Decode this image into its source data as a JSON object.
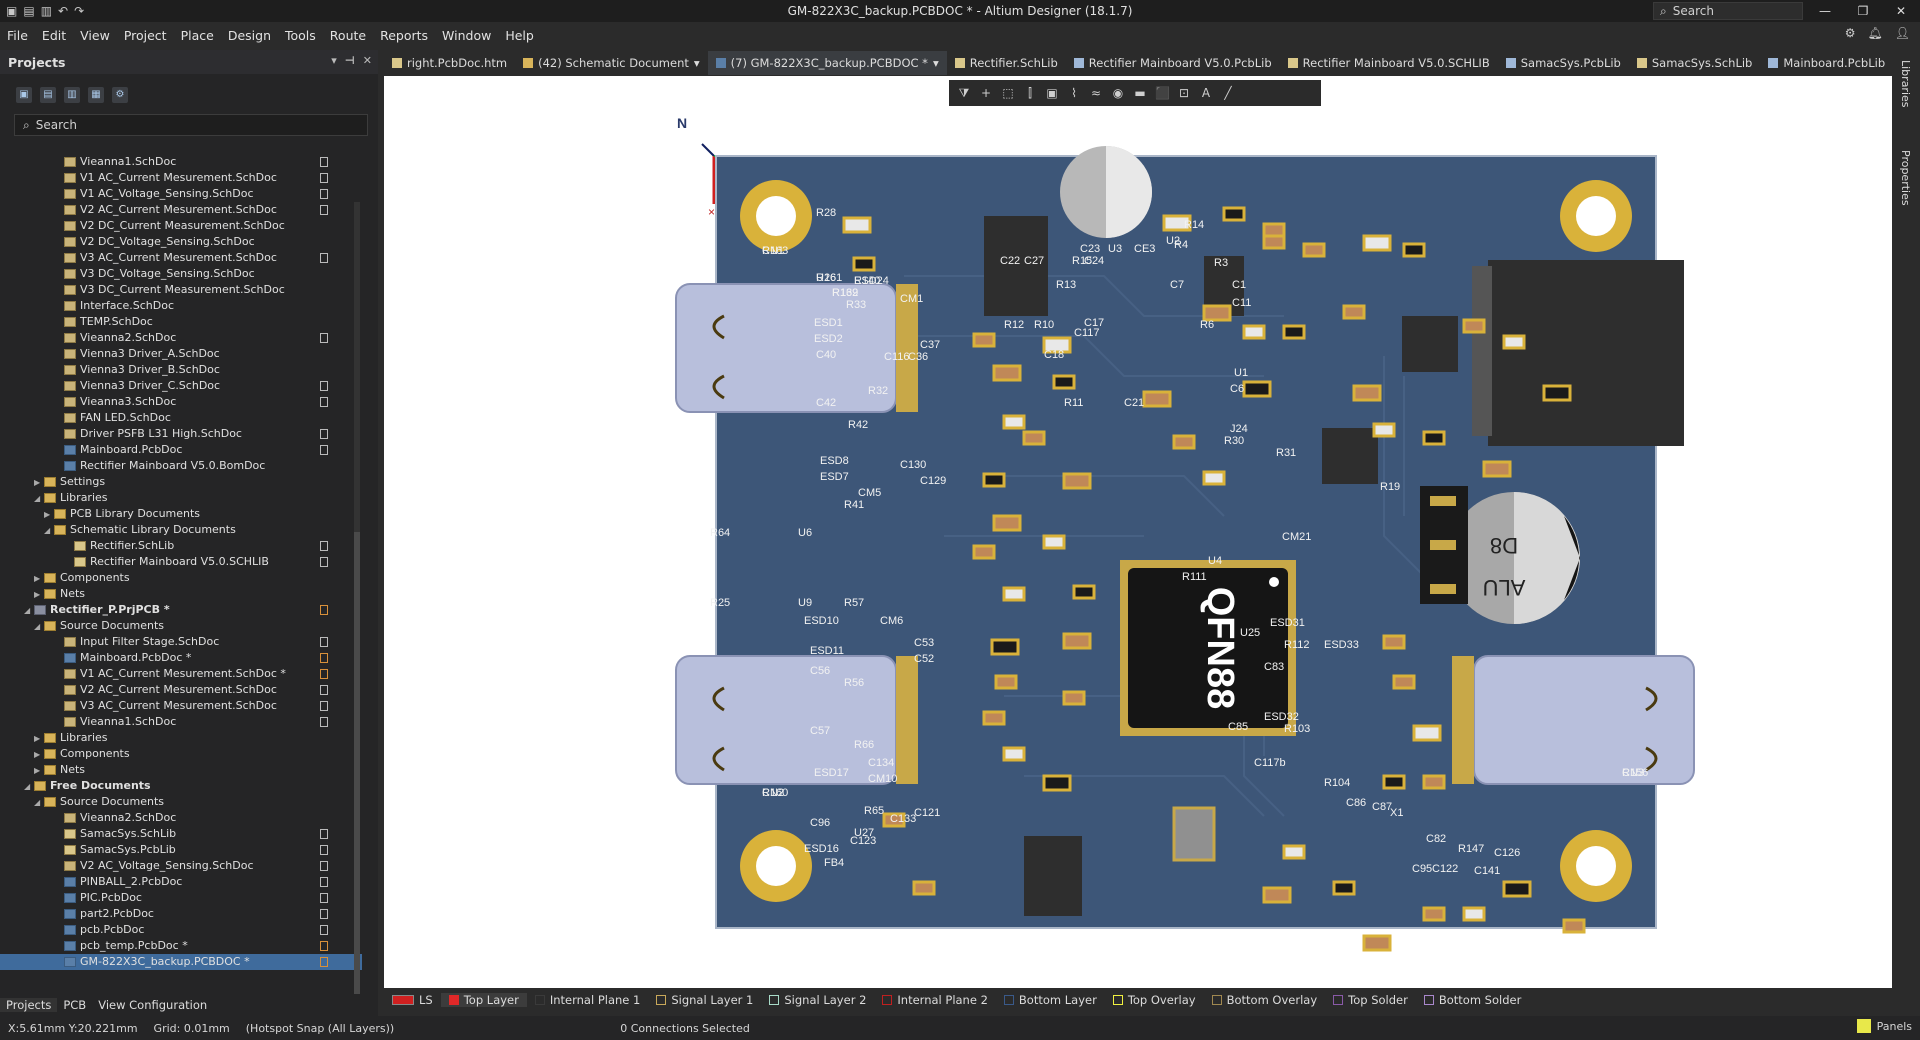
{
  "window": {
    "title": "GM-822X3C_backup.PCBDOC * - Altium Designer (18.1.7)",
    "search_label": "Search",
    "controls": [
      "—",
      "❐",
      "✕"
    ]
  },
  "menu": [
    "File",
    "Edit",
    "View",
    "Project",
    "Place",
    "Design",
    "Tools",
    "Route",
    "Reports",
    "Window",
    "Help"
  ],
  "projects_panel": {
    "title": "Projects",
    "search_placeholder": "Search",
    "tree": [
      {
        "label": "Vieanna1.SchDoc",
        "indent": 4,
        "icon": "doc",
        "badge": "file"
      },
      {
        "label": "V1 AC_Current Mesurement.SchDoc",
        "indent": 4,
        "icon": "doc",
        "badge": "file"
      },
      {
        "label": "V1 AC_Voltage_Sensing.SchDoc",
        "indent": 4,
        "icon": "doc",
        "badge": "file"
      },
      {
        "label": "V2 AC_Current Mesurement.SchDoc",
        "indent": 4,
        "icon": "doc",
        "badge": "file"
      },
      {
        "label": "V2 DC_Current Measurement.SchDoc",
        "indent": 4,
        "icon": "doc",
        "badge": ""
      },
      {
        "label": "V2 DC_Voltage_Sensing.SchDoc",
        "indent": 4,
        "icon": "doc",
        "badge": ""
      },
      {
        "label": "V3 AC_Current Mesurement.SchDoc",
        "indent": 4,
        "icon": "doc",
        "badge": "file"
      },
      {
        "label": "V3 DC_Voltage_Sensing.SchDoc",
        "indent": 4,
        "icon": "doc",
        "badge": ""
      },
      {
        "label": "V3 DC_Current Measurement.SchDoc",
        "indent": 4,
        "icon": "doc",
        "badge": ""
      },
      {
        "label": "Interface.SchDoc",
        "indent": 4,
        "icon": "doc",
        "badge": ""
      },
      {
        "label": "TEMP.SchDoc",
        "indent": 4,
        "icon": "doc",
        "badge": ""
      },
      {
        "label": "Vieanna2.SchDoc",
        "indent": 4,
        "icon": "doc",
        "badge": "file"
      },
      {
        "label": "Vienna3 Driver_A.SchDoc",
        "indent": 4,
        "icon": "doc",
        "badge": ""
      },
      {
        "label": "Vienna3 Driver_B.SchDoc",
        "indent": 4,
        "icon": "doc",
        "badge": ""
      },
      {
        "label": "Vienna3 Driver_C.SchDoc",
        "indent": 4,
        "icon": "doc",
        "badge": "file"
      },
      {
        "label": "Vieanna3.SchDoc",
        "indent": 4,
        "icon": "doc",
        "badge": "file"
      },
      {
        "label": "FAN LED.SchDoc",
        "indent": 4,
        "icon": "doc",
        "badge": ""
      },
      {
        "label": "Driver PSFB L31 High.SchDoc",
        "indent": 4,
        "icon": "doc",
        "badge": "file"
      },
      {
        "label": "Mainboard.PcbDoc",
        "indent": 4,
        "icon": "pcb",
        "badge": "file"
      },
      {
        "label": "Rectifier Mainboard V5.0.BomDoc",
        "indent": 4,
        "icon": "pcb",
        "badge": ""
      },
      {
        "label": "Settings",
        "indent": 2,
        "icon": "folder",
        "arrow": "▶",
        "badge": ""
      },
      {
        "label": "Libraries",
        "indent": 2,
        "icon": "folder",
        "arrow": "◢",
        "badge": ""
      },
      {
        "label": "PCB Library Documents",
        "indent": 3,
        "icon": "folder",
        "arrow": "▶",
        "badge": ""
      },
      {
        "label": "Schematic Library Documents",
        "indent": 3,
        "icon": "folder",
        "arrow": "◢",
        "badge": ""
      },
      {
        "label": "Rectifier.SchLib",
        "indent": 5,
        "icon": "lib",
        "badge": "file"
      },
      {
        "label": "Rectifier Mainboard V5.0.SCHLIB",
        "indent": 5,
        "icon": "lib",
        "badge": "file"
      },
      {
        "label": "Components",
        "indent": 2,
        "icon": "folder",
        "arrow": "▶",
        "badge": ""
      },
      {
        "label": "Nets",
        "indent": 2,
        "icon": "folder",
        "arrow": "▶",
        "badge": ""
      },
      {
        "label": "Rectifier_P.PrjPCB *",
        "indent": 1,
        "icon": "prj",
        "arrow": "◢",
        "badge": "mod",
        "bold": true
      },
      {
        "label": "Source Documents",
        "indent": 2,
        "icon": "folder",
        "arrow": "◢",
        "badge": ""
      },
      {
        "label": "Input Filter Stage.SchDoc",
        "indent": 4,
        "icon": "doc",
        "badge": "file"
      },
      {
        "label": "Mainboard.PcbDoc *",
        "indent": 4,
        "icon": "pcb",
        "badge": "mod"
      },
      {
        "label": "V1 AC_Current Mesurement.SchDoc *",
        "indent": 4,
        "icon": "doc",
        "badge": "mod"
      },
      {
        "label": "V2 AC_Current Mesurement.SchDoc",
        "indent": 4,
        "icon": "doc",
        "badge": "file"
      },
      {
        "label": "V3 AC_Current Mesurement.SchDoc",
        "indent": 4,
        "icon": "doc",
        "badge": "file"
      },
      {
        "label": "Vieanna1.SchDoc",
        "indent": 4,
        "icon": "doc",
        "badge": "file"
      },
      {
        "label": "Libraries",
        "indent": 2,
        "icon": "folder",
        "arrow": "▶",
        "badge": ""
      },
      {
        "label": "Components",
        "indent": 2,
        "icon": "folder",
        "arrow": "▶",
        "badge": ""
      },
      {
        "label": "Nets",
        "indent": 2,
        "icon": "folder",
        "arrow": "▶",
        "badge": ""
      },
      {
        "label": "Free Documents",
        "indent": 1,
        "icon": "folder",
        "arrow": "◢",
        "badge": "",
        "bold": true
      },
      {
        "label": "Source Documents",
        "indent": 2,
        "icon": "folder",
        "arrow": "◢",
        "badge": ""
      },
      {
        "label": "Vieanna2.SchDoc",
        "indent": 4,
        "icon": "doc",
        "badge": ""
      },
      {
        "label": "SamacSys.SchLib",
        "indent": 4,
        "icon": "lib",
        "badge": "file"
      },
      {
        "label": "SamacSys.PcbLib",
        "indent": 4,
        "icon": "lib",
        "badge": "file"
      },
      {
        "label": "V2 AC_Voltage_Sensing.SchDoc",
        "indent": 4,
        "icon": "doc",
        "badge": "file"
      },
      {
        "label": "PINBALL_2.PcbDoc",
        "indent": 4,
        "icon": "pcb",
        "badge": "file"
      },
      {
        "label": "PIC.PcbDoc",
        "indent": 4,
        "icon": "pcb",
        "badge": "file"
      },
      {
        "label": "part2.PcbDoc",
        "indent": 4,
        "icon": "pcb",
        "badge": "file"
      },
      {
        "label": "pcb.PcbDoc",
        "indent": 4,
        "icon": "pcb",
        "badge": "file"
      },
      {
        "label": "pcb_temp.PcbDoc *",
        "indent": 4,
        "icon": "pcb",
        "badge": "mod"
      },
      {
        "label": "GM-822X3C_backup.PCBDOC *",
        "indent": 4,
        "icon": "pcb",
        "badge": "mod",
        "selected": true
      }
    ],
    "bottom_tabs": [
      "Projects",
      "PCB",
      "View Configuration"
    ]
  },
  "doc_tabs": [
    {
      "label": "right.PcbDoc.htm",
      "icon": "htm"
    },
    {
      "label": "(42) Schematic Document",
      "icon": "folder",
      "dropdown": true
    },
    {
      "label": "(7) GM-822X3C_backup.PCBDOC *",
      "icon": "pcb",
      "dropdown": true,
      "active": true
    },
    {
      "label": "Rectifier.SchLib",
      "icon": "lib"
    },
    {
      "label": "Rectifier Mainboard V5.0.PcbLib",
      "icon": "pcblib"
    },
    {
      "label": "Rectifier Mainboard V5.0.SCHLIB",
      "icon": "lib"
    },
    {
      "label": "SamacSys.PcbLib",
      "icon": "pcblib"
    },
    {
      "label": "SamacSys.SchLib",
      "icon": "lib"
    },
    {
      "label": "Mainboard.PcbLib",
      "icon": "pcblib"
    },
    {
      "label": "left.PcbDoc.htm",
      "icon": "htm"
    }
  ],
  "pcb_toolbar": [
    "filter-icon",
    "plus-icon",
    "rect-select-icon",
    "align-icon",
    "component-icon",
    "route-icon",
    "diff-route-icon",
    "via-icon",
    "fill-icon",
    "region-icon",
    "dimension-icon",
    "text-icon",
    "line-icon"
  ],
  "right_rail": [
    "Libraries",
    "Properties"
  ],
  "board": {
    "compass": "N",
    "chip_label": "QFN88",
    "cap_text": "ALU",
    "cap_id": "D8",
    "labels": [
      "CN1",
      "CN2",
      "CN3",
      "U26",
      "R140",
      "R139",
      "R33",
      "CM1",
      "ESD1",
      "ESD2",
      "C40",
      "C42",
      "R32",
      "C36",
      "C37",
      "C116",
      "R42",
      "ESD8",
      "ESD7",
      "C130",
      "C129",
      "R41",
      "CM5",
      "ESD10",
      "R57",
      "CM6",
      "C53",
      "C52",
      "ESD11",
      "C56",
      "R56",
      "C57",
      "ESD17",
      "R66",
      "C134",
      "CM10",
      "R65",
      "C133",
      "C121",
      "C96",
      "ESD16",
      "C123",
      "U27",
      "FB4",
      "R64",
      "U6",
      "R25",
      "U9",
      "R28",
      "C117",
      "U3",
      "CE3",
      "R13",
      "C23",
      "C22",
      "C27",
      "R15",
      "C24",
      "R12",
      "R10",
      "C17",
      "C18",
      "R11",
      "C21",
      "U2",
      "R14",
      "R4",
      "C7",
      "R3",
      "R6",
      "C1",
      "C11",
      "U1",
      "C6",
      "J24",
      "R30",
      "R31",
      "R19",
      "U4",
      "R111",
      "CM21",
      "ESD31",
      "U25",
      "R112",
      "ESD33",
      "C83",
      "C85",
      "ESD32",
      "R103",
      "C117b",
      "R104",
      "C86",
      "C87",
      "X1",
      "C82",
      "C95",
      "C122",
      "R147",
      "C141",
      "C126",
      "R163",
      "R160",
      "R156",
      "R161",
      "ESD24",
      "R162"
    ]
  },
  "layers": [
    {
      "label": "LS",
      "color": "#d02020",
      "active_ls": true
    },
    {
      "label": "Top Layer",
      "color": "#e02828",
      "active": true
    },
    {
      "label": "Internal Plane 1",
      "color": "#3a3a3a"
    },
    {
      "label": "Signal Layer 1",
      "color": "#c8a85a"
    },
    {
      "label": "Signal Layer 2",
      "color": "#a8dcc8"
    },
    {
      "label": "Internal Plane 2",
      "color": "#c02020"
    },
    {
      "label": "Bottom Layer",
      "color": "#3a5a8a"
    },
    {
      "label": "Top Overlay",
      "color": "#f0f040"
    },
    {
      "label": "Bottom Overlay",
      "color": "#a08850"
    },
    {
      "label": "Top Solder",
      "color": "#8a5aa8"
    },
    {
      "label": "Bottom Solder",
      "color": "#aa88cc"
    }
  ],
  "status": {
    "coords": "X:5.61mm Y:20.221mm",
    "grid": "Grid: 0.01mm",
    "snap": "(Hotspot Snap (All Layers))",
    "connections": "0 Connections Selected",
    "panels": "Panels"
  }
}
